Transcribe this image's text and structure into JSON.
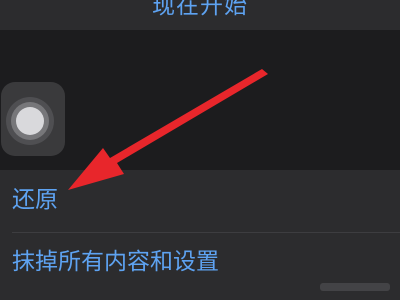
{
  "settings": {
    "start_now_label": "现在开始",
    "rows": [
      {
        "label": "还原"
      },
      {
        "label": "抹掉所有内容和设置"
      }
    ]
  },
  "annotation": {
    "arrow_color": "#e8262b"
  },
  "colors": {
    "accent": "#5ea3f2",
    "background": "#1c1c1e",
    "cell": "#2c2c2e"
  }
}
